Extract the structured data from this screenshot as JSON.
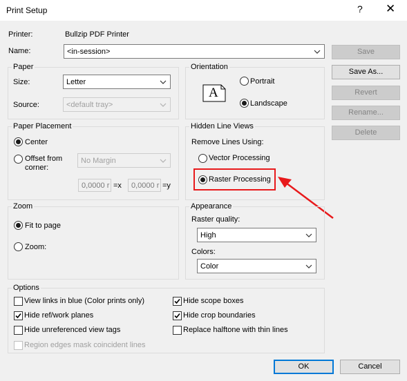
{
  "window": {
    "title": "Print Setup",
    "help_glyph": "?",
    "close_glyph": "✕"
  },
  "printer": {
    "label": "Printer:",
    "value": "Bullzip PDF Printer"
  },
  "name": {
    "label": "Name:",
    "value": "<in-session>"
  },
  "buttons": {
    "save": "Save",
    "save_as": "Save As...",
    "revert": "Revert",
    "rename": "Rename...",
    "delete": "Delete",
    "ok": "OK",
    "cancel": "Cancel"
  },
  "paper": {
    "title": "Paper",
    "size_label": "Size:",
    "size_value": "Letter",
    "source_label": "Source:",
    "source_value": "<default tray>"
  },
  "orientation": {
    "title": "Orientation",
    "icon_letter": "A",
    "portrait": "Portrait",
    "landscape": "Landscape",
    "selected": "landscape"
  },
  "placement": {
    "title": "Paper Placement",
    "center": "Center",
    "offset_line1": "Offset from",
    "offset_line2": "corner:",
    "margin_value": "No Margin",
    "x_value": "0,0000 r",
    "x_label": "=x",
    "y_value": "0,0000 r",
    "y_label": "=y",
    "selected": "center"
  },
  "hidden_lines": {
    "title": "Hidden Line Views",
    "remove_label": "Remove Lines Using:",
    "vector": "Vector Processing",
    "raster": "Raster Processing",
    "selected": "raster"
  },
  "zoom": {
    "title": "Zoom",
    "fit": "Fit to page",
    "zoom": "Zoom:",
    "selected": "fit"
  },
  "appearance": {
    "title": "Appearance",
    "quality_label": "Raster quality:",
    "quality_value": "High",
    "colors_label": "Colors:",
    "colors_value": "Color"
  },
  "options": {
    "title": "Options",
    "items": [
      {
        "label": "View links in blue (Color prints only)",
        "checked": false,
        "enabled": true
      },
      {
        "label": "Hide ref/work planes",
        "checked": true,
        "enabled": true
      },
      {
        "label": "Hide unreferenced view tags",
        "checked": false,
        "enabled": true
      },
      {
        "label": "Region edges mask coincident lines",
        "checked": false,
        "enabled": false
      },
      {
        "label": "Hide scope boxes",
        "checked": true,
        "enabled": true
      },
      {
        "label": "Hide crop boundaries",
        "checked": true,
        "enabled": true
      },
      {
        "label": "Replace halftone with thin lines",
        "checked": false,
        "enabled": true
      }
    ]
  },
  "annotation": {
    "highlight_color": "#e8191b",
    "accent_color": "#0078d7"
  }
}
